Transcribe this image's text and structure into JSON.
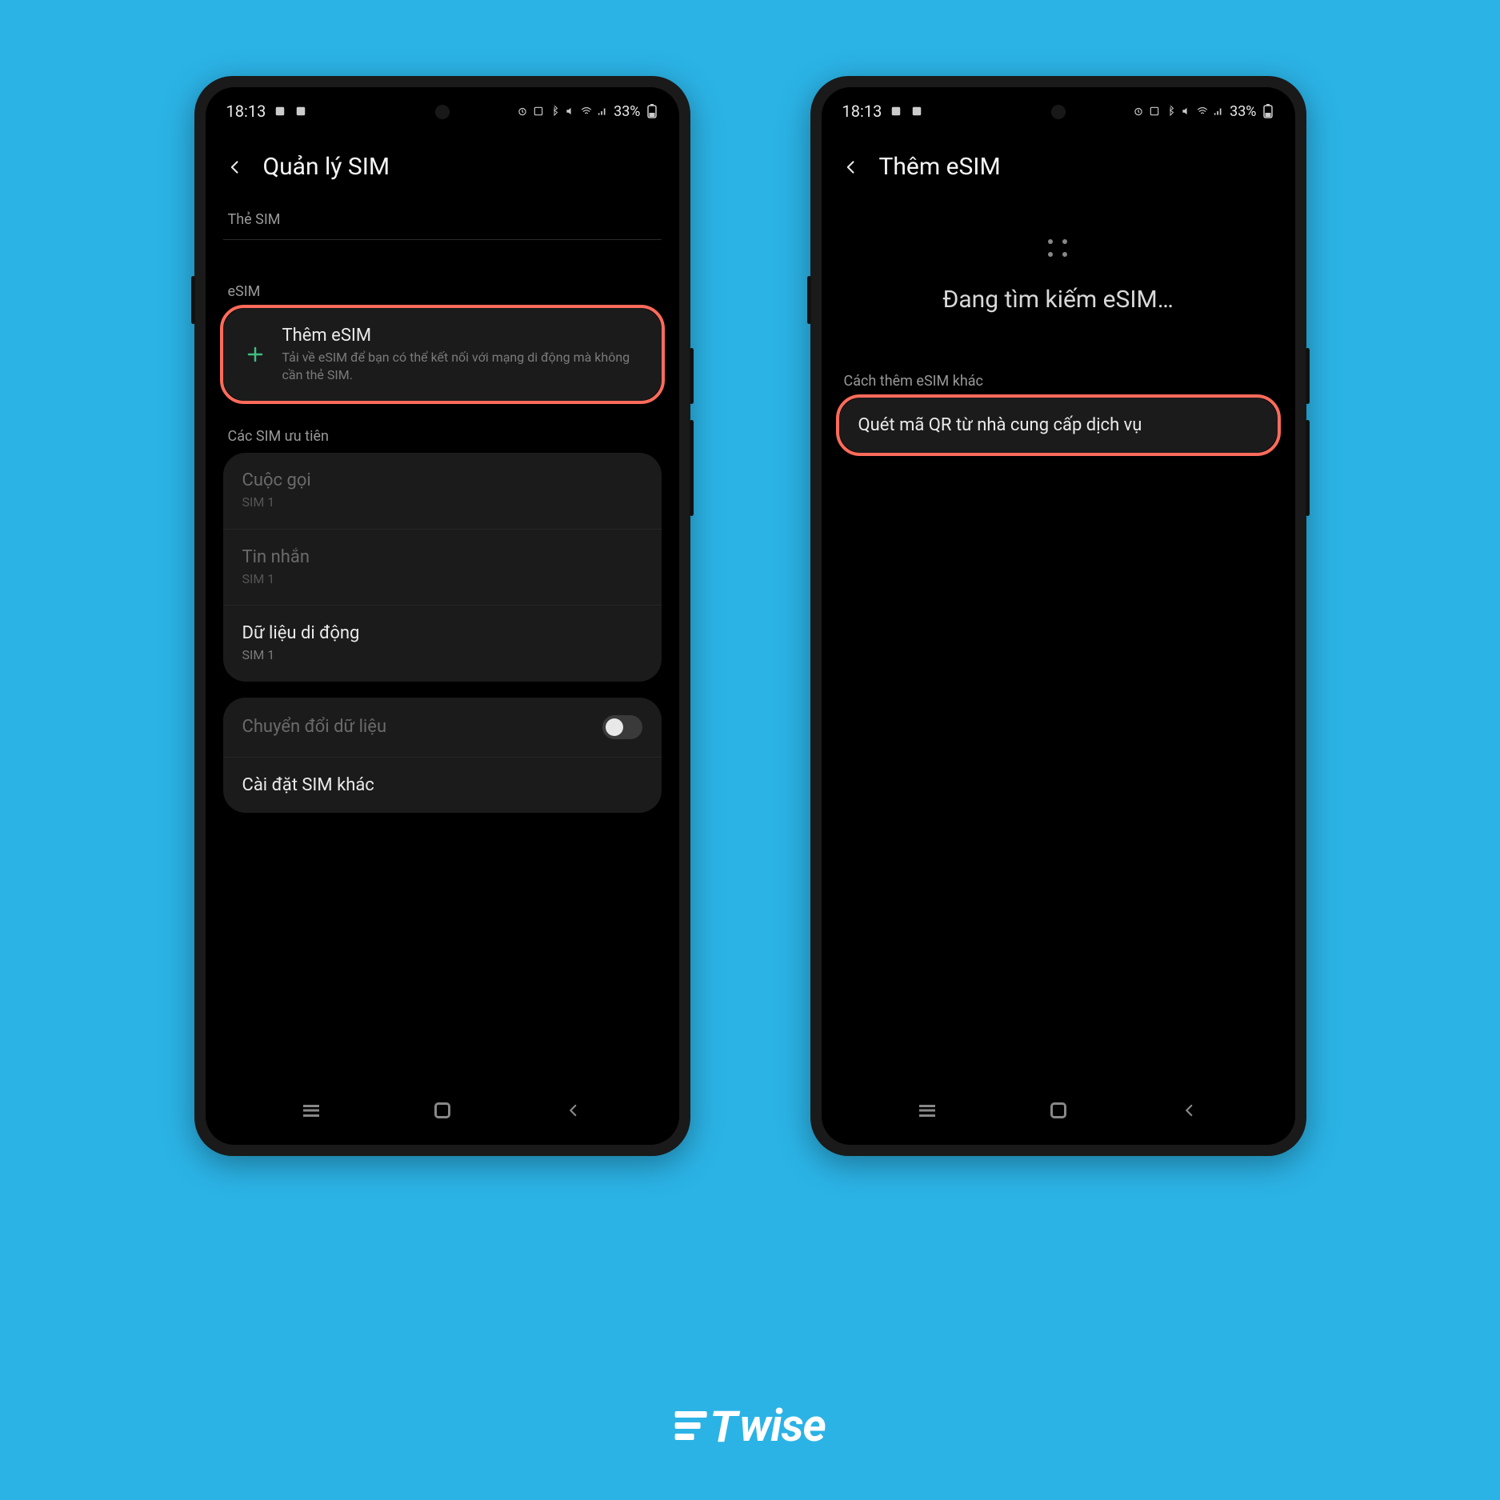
{
  "status": {
    "time": "18:13",
    "battery_text": "33%"
  },
  "phone1": {
    "header_title": "Quản lý SIM",
    "section_sim": "Thẻ SIM",
    "section_esim": "eSIM",
    "add_esim_title": "Thêm eSIM",
    "add_esim_sub": "Tải về eSIM để bạn có thể kết nối với mạng di động mà không cần thẻ SIM.",
    "section_preferred": "Các SIM ưu tiên",
    "call_title": "Cuộc gọi",
    "call_sub": "SIM 1",
    "msg_title": "Tin nhắn",
    "msg_sub": "SIM 1",
    "data_title": "Dữ liệu di động",
    "data_sub": "SIM 1",
    "switch_title": "Chuyển đổi dữ liệu",
    "other_title": "Cài đặt SIM khác"
  },
  "phone2": {
    "header_title": "Thêm eSIM",
    "searching_text": "Đang tìm kiếm eSIM…",
    "section_other": "Cách thêm eSIM khác",
    "scan_qr": "Quét mã QR từ nhà cung cấp dịch vụ"
  },
  "brand": "wise"
}
